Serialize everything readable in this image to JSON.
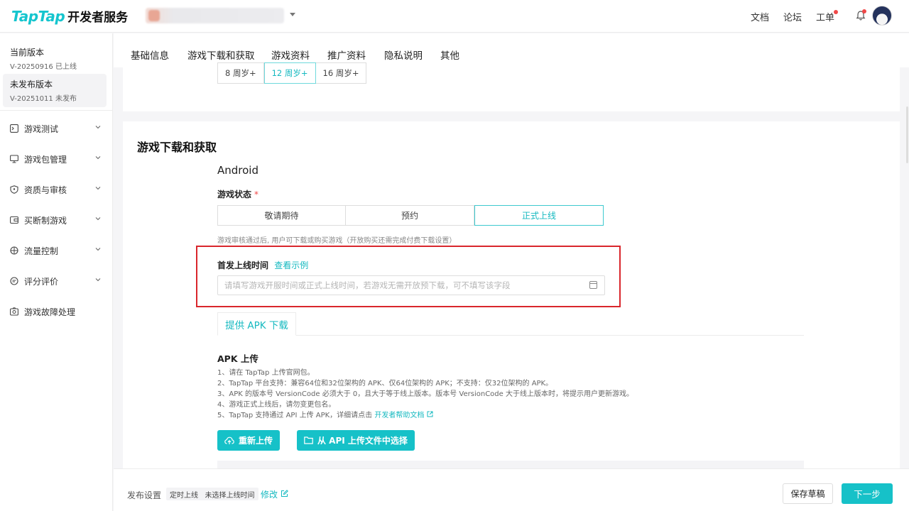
{
  "header": {
    "logo_tap": "TapTap",
    "logo_sub": "开发者服务",
    "nav": [
      "文档",
      "论坛",
      "工单"
    ]
  },
  "sidebar": {
    "versions": [
      {
        "title": "当前版本",
        "sub": "V-20250916 已上线"
      },
      {
        "title": "未发布版本",
        "sub": "V-20251011 未发布"
      }
    ],
    "menu": [
      {
        "label": "游戏测试",
        "icon": "terminal-icon"
      },
      {
        "label": "游戏包管理",
        "icon": "monitor-icon"
      },
      {
        "label": "资质与审核",
        "icon": "shield-icon"
      },
      {
        "label": "买断制游戏",
        "icon": "wallet-icon"
      },
      {
        "label": "流量控制",
        "icon": "target-icon"
      },
      {
        "label": "评分评价",
        "icon": "comment-icon"
      },
      {
        "label": "游戏故障处理",
        "icon": "camera-icon"
      }
    ]
  },
  "tabs": [
    "基础信息",
    "游戏下载和获取",
    "游戏资料",
    "推广资料",
    "隐私说明",
    "其他"
  ],
  "age_rating": {
    "options": [
      "8 周岁+",
      "12 周岁+",
      "16 周岁+"
    ],
    "selected": "12 周岁+"
  },
  "download_section": {
    "title": "游戏下载和获取",
    "platform": "Android",
    "status_label": "游戏状态",
    "required_mark": "*",
    "status_options": [
      "敬请期待",
      "预约",
      "正式上线"
    ],
    "status_selected": "正式上线",
    "status_hint": "游戏审核通过后, 用户可下载或购买游戏（开放购买还需完成付费下载设置）",
    "launch_time_label": "首发上线时间",
    "launch_time_link": "查看示例",
    "launch_time_placeholder": "请填写游戏开服时间或正式上线时间，若游戏无需开放预下载，可不填写该字段",
    "subtab": "提供 APK 下载",
    "apk_title": "APK 上传",
    "apk_notes": [
      "1、请在 TapTap 上传官网包。",
      "2、TapTap 平台支持：兼容64位和32位架构的 APK、仅64位架构的 APK；不支持：仅32位架构的 APK。",
      "3、APK 的版本号 VersionCode 必须大于 0，且大于等于线上版本。版本号 VersionCode 大于线上版本时，将提示用户更新游戏。",
      "4、游戏正式上线后，请勿变更包名。",
      "5、TapTap 支持通过 API 上传 APK，详细请点击 "
    ],
    "apk_help_link": "开发者帮助文档",
    "reupload_button": "重新上传",
    "api_select_button": "从 API 上传文件中选择"
  },
  "footer": {
    "publish_label": "发布设置",
    "publish_tag": "定时上线   未选择上线时间",
    "edit_label": "修改",
    "save_draft": "保存草稿",
    "next": "下一步"
  },
  "colors": {
    "accent": "#16c1c8",
    "highlight_box": "#d9262c",
    "notification": "#f04848"
  }
}
